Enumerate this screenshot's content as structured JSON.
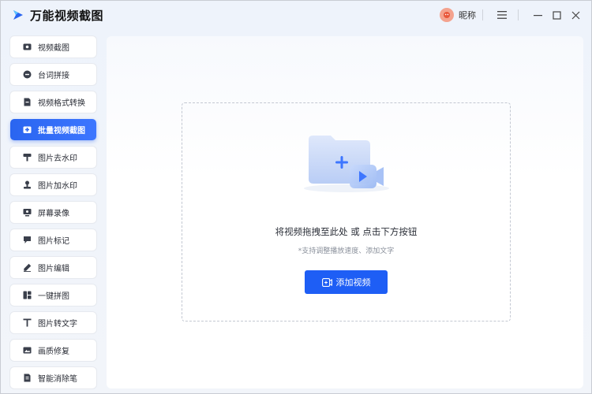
{
  "app": {
    "title": "万能视频截图",
    "user_name": "昵称",
    "brand_color": "#1e5ef5"
  },
  "window_controls": {
    "menu_icon": "hamburger-icon",
    "minimize_icon": "minimize-icon",
    "maximize_icon": "maximize-icon",
    "close_icon": "close-icon"
  },
  "sidebar": {
    "items": [
      {
        "label": "视频截图",
        "icon": "video-screenshot-icon",
        "active": false
      },
      {
        "label": "台词拼接",
        "icon": "subtitle-stitch-icon",
        "active": false
      },
      {
        "label": "视频格式转换",
        "icon": "format-convert-icon",
        "active": false
      },
      {
        "label": "批量视频截图",
        "icon": "batch-screenshot-icon",
        "active": true
      },
      {
        "label": "图片去水印",
        "icon": "remove-watermark-icon",
        "active": false
      },
      {
        "label": "图片加水印",
        "icon": "add-watermark-icon",
        "active": false
      },
      {
        "label": "屏幕录像",
        "icon": "screen-record-icon",
        "active": false
      },
      {
        "label": "图片标记",
        "icon": "image-mark-icon",
        "active": false
      },
      {
        "label": "图片编辑",
        "icon": "image-edit-icon",
        "active": false
      },
      {
        "label": "一键拼图",
        "icon": "collage-icon",
        "active": false
      },
      {
        "label": "图片转文字",
        "icon": "text-icon",
        "active": false
      },
      {
        "label": "画质修复",
        "icon": "image-repair-icon",
        "active": false
      },
      {
        "label": "智能消除笔",
        "icon": "eraser-icon",
        "active": false
      }
    ]
  },
  "main": {
    "drop_title": "将视频拖拽至此处 或 点击下方按钮",
    "drop_hint": "*支持调整播放速度、添加文字",
    "add_button_label": "添加视频"
  }
}
